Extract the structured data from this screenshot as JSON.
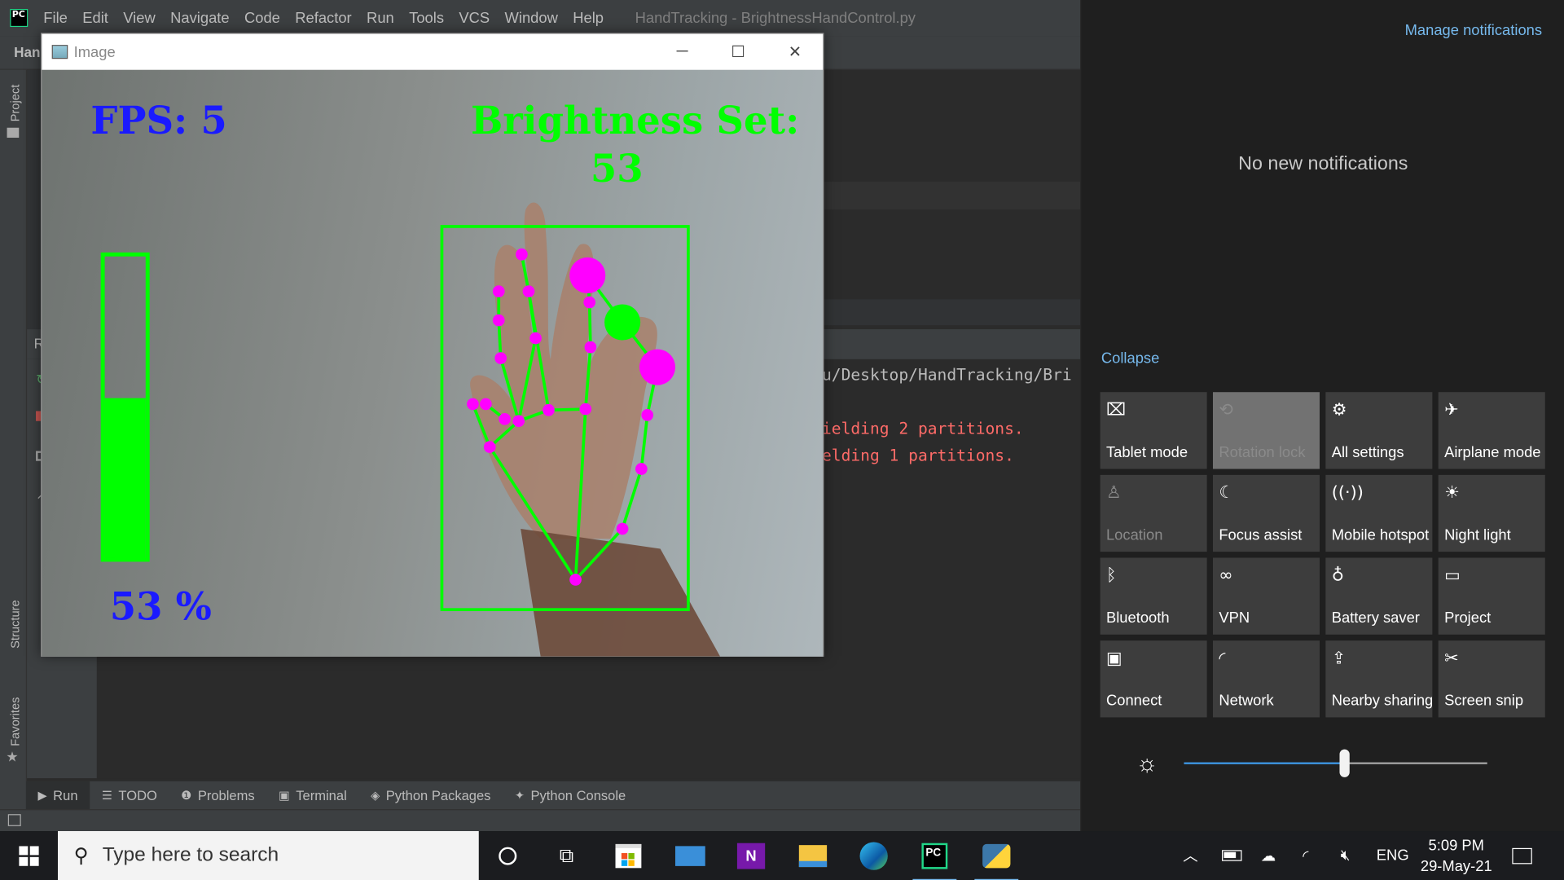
{
  "ide": {
    "menu": [
      "File",
      "Edit",
      "View",
      "Navigate",
      "Code",
      "Refactor",
      "Run",
      "Tools",
      "VCS",
      "Window",
      "Help"
    ],
    "window_title": "HandTracking - BrightnessHandControl.py",
    "project_crumb": "Han",
    "left_tabs": {
      "project": "Project",
      "structure": "Structure",
      "favorites": "Favorites"
    },
    "run_gutter_label": "R",
    "console": {
      "path_line": "u/Desktop/HandTracking/Bri",
      "error_line_1": "ielding 2 partitions.",
      "error_line_2": "elding 1 partitions."
    },
    "bottom_tabs": [
      "Run",
      "TODO",
      "Problems",
      "Terminal",
      "Python Packages",
      "Python Console"
    ]
  },
  "image_window": {
    "title": "Image",
    "fps_text": "FPS: 5",
    "brightness_text_1": "Brightness Set:",
    "brightness_text_2": "53",
    "percent_text": "53 %",
    "bar_level": 0.53,
    "colors": {
      "fps": "#1a1aff",
      "bright": "#00ff00",
      "landmark": "#ff00ff",
      "bone": "#00ff00"
    }
  },
  "action_center": {
    "manage": "Manage notifications",
    "no_new": "No new notifications",
    "collapse": "Collapse",
    "tiles": [
      {
        "label": "Tablet mode",
        "icon": "tablet-icon",
        "glyph": "⌧",
        "state": "normal"
      },
      {
        "label": "Rotation lock",
        "icon": "rotation-lock-icon",
        "glyph": "⟲",
        "state": "lit-dim"
      },
      {
        "label": "All settings",
        "icon": "gear-icon",
        "glyph": "⚙",
        "state": "normal"
      },
      {
        "label": "Airplane mode",
        "icon": "airplane-icon",
        "glyph": "✈",
        "state": "normal"
      },
      {
        "label": "Location",
        "icon": "location-icon",
        "glyph": "♙",
        "state": "dim"
      },
      {
        "label": "Focus assist",
        "icon": "moon-icon",
        "glyph": "☾",
        "state": "normal"
      },
      {
        "label": "Mobile hotspot",
        "icon": "hotspot-icon",
        "glyph": "((·))",
        "state": "normal"
      },
      {
        "label": "Night light",
        "icon": "night-light-icon",
        "glyph": "☀",
        "state": "normal"
      },
      {
        "label": "Bluetooth",
        "icon": "bluetooth-icon",
        "glyph": "ᛒ",
        "state": "normal"
      },
      {
        "label": "VPN",
        "icon": "vpn-icon",
        "glyph": "∞",
        "state": "normal"
      },
      {
        "label": "Battery saver",
        "icon": "battery-saver-icon",
        "glyph": "♁",
        "state": "normal"
      },
      {
        "label": "Project",
        "icon": "project-icon",
        "glyph": "▭",
        "state": "normal"
      },
      {
        "label": "Connect",
        "icon": "connect-icon",
        "glyph": "▣",
        "state": "normal"
      },
      {
        "label": "Network",
        "icon": "network-icon",
        "glyph": "◜",
        "state": "normal"
      },
      {
        "label": "Nearby sharing",
        "icon": "nearby-sharing-icon",
        "glyph": "⇪",
        "state": "normal"
      },
      {
        "label": "Screen snip",
        "icon": "scissors-icon",
        "glyph": "✂",
        "state": "normal"
      }
    ],
    "brightness": 0.53
  },
  "taskbar": {
    "search_placeholder": "Type here to search",
    "language": "ENG",
    "time": "5:09 PM",
    "date": "29-May-21"
  }
}
